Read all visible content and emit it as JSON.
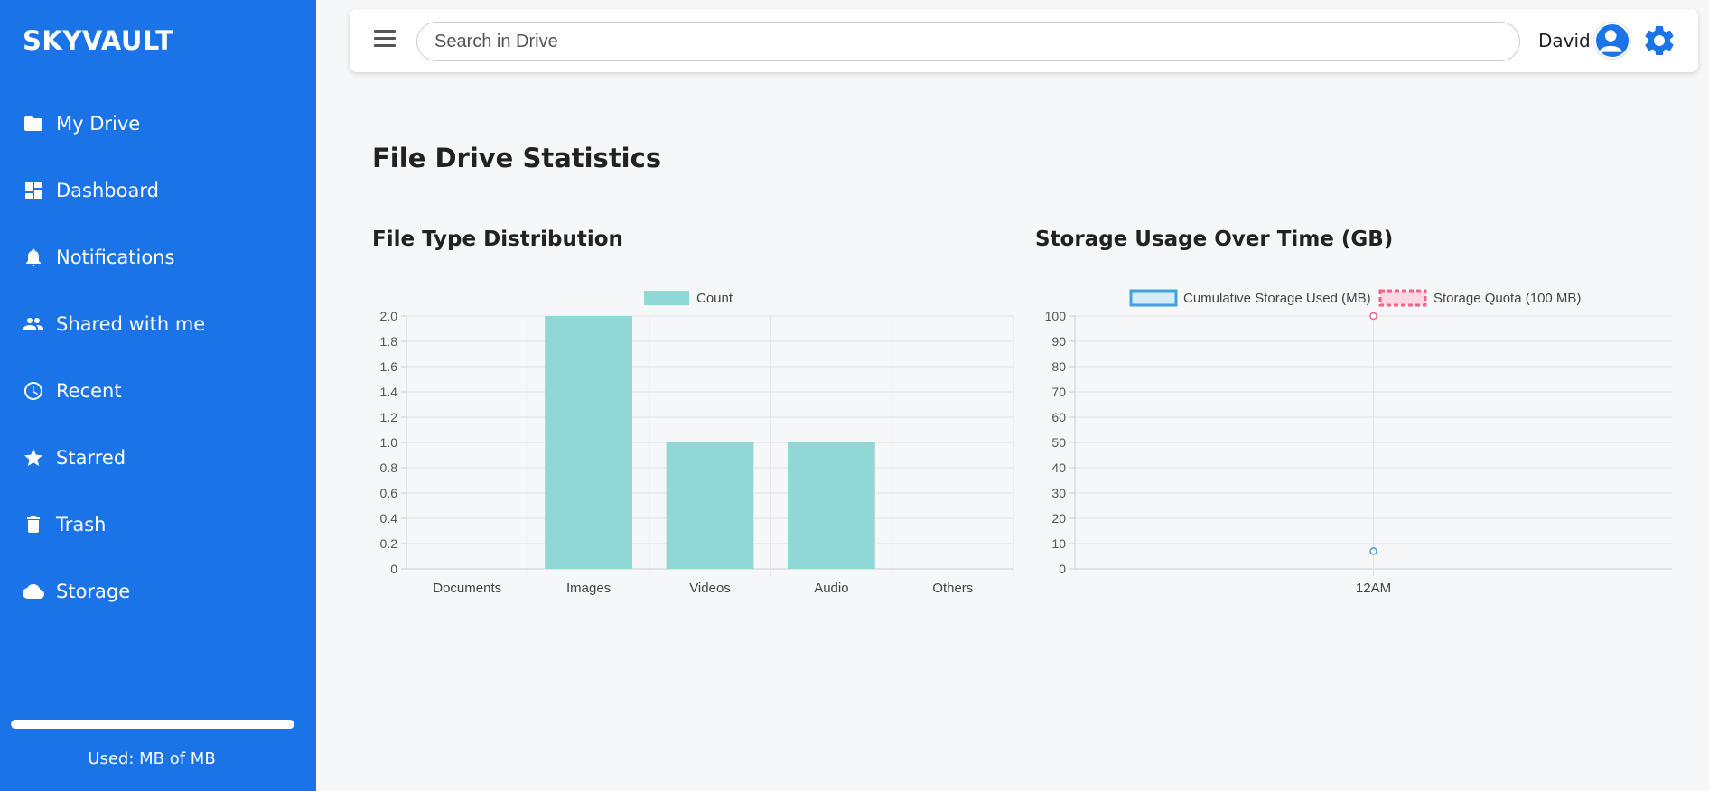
{
  "sidebar": {
    "brand": "SKYVAULT",
    "items": [
      {
        "label": "My Drive",
        "icon": "folder-icon"
      },
      {
        "label": "Dashboard",
        "icon": "dashboard-icon"
      },
      {
        "label": "Notifications",
        "icon": "bell-icon"
      },
      {
        "label": "Shared with me",
        "icon": "people-icon"
      },
      {
        "label": "Recent",
        "icon": "clock-icon"
      },
      {
        "label": "Starred",
        "icon": "star-icon"
      },
      {
        "label": "Trash",
        "icon": "trash-icon"
      },
      {
        "label": "Storage",
        "icon": "cloud-icon"
      }
    ],
    "storage_text": "Used: MB of MB",
    "storage_fraction": 0
  },
  "topbar": {
    "search_placeholder": "Search in Drive",
    "user_name": "David"
  },
  "colors": {
    "brand": "#1b73e8",
    "bar": "#8fd8d6",
    "line_used": "#3ea2dd",
    "line_quota": "#f0648a"
  },
  "main": {
    "title": "File Drive Statistics"
  },
  "chart_data": [
    {
      "id": "chart1",
      "title": "File Type Distribution",
      "type": "bar",
      "categories": [
        "Documents",
        "Images",
        "Videos",
        "Audio",
        "Others"
      ],
      "series": [
        {
          "name": "Count",
          "values": [
            0,
            2,
            1,
            1,
            0
          ]
        }
      ],
      "ylim": [
        0,
        2
      ],
      "yticks": [
        "2.0",
        "1.8",
        "1.6",
        "1.4",
        "1.2",
        "1.0",
        "0.8",
        "0.6",
        "0.4",
        "0.2",
        "0"
      ],
      "legend": "top",
      "grid": true
    },
    {
      "id": "chart2",
      "title": "Storage Usage Over Time (GB)",
      "type": "line",
      "categories": [
        "12AM"
      ],
      "series": [
        {
          "name": "Cumulative Storage Used (MB)",
          "values": [
            7
          ]
        },
        {
          "name": "Storage Quota (100 MB)",
          "values": [
            100
          ]
        }
      ],
      "ylim": [
        0,
        100
      ],
      "yticks": [
        "100",
        "90",
        "80",
        "70",
        "60",
        "50",
        "40",
        "30",
        "20",
        "10",
        "0"
      ],
      "legend": "top",
      "grid": true
    }
  ]
}
